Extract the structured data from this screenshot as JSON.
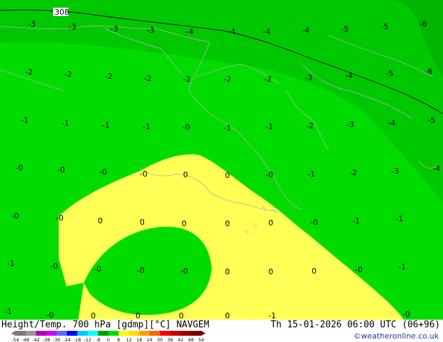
{
  "map": {
    "contour_label": "308",
    "zones": {
      "dark_green": "#00b400",
      "mid_green": "#00c800",
      "bright_green": "#00dc00",
      "yellow": "#ffff55",
      "coast": "#b0b0b0",
      "contour": "#000000"
    },
    "isolines": [
      {
        "t": "-3"
      },
      {
        "t": "-3"
      },
      {
        "t": "-3"
      },
      {
        "t": "-3"
      },
      {
        "t": "-4"
      },
      {
        "t": "-4"
      },
      {
        "t": "-4"
      },
      {
        "t": "-4"
      },
      {
        "t": "-5"
      },
      {
        "t": "-5"
      },
      {
        "t": "-6"
      },
      {
        "t": "-2"
      },
      {
        "t": "-2"
      },
      {
        "t": "-2"
      },
      {
        "t": "-2"
      },
      {
        "t": "-2"
      },
      {
        "t": "-2"
      },
      {
        "t": "-2"
      },
      {
        "t": "-3"
      },
      {
        "t": "-4"
      },
      {
        "t": "-5"
      },
      {
        "t": "-6"
      },
      {
        "t": "-1"
      },
      {
        "t": "-1"
      },
      {
        "t": "-1"
      },
      {
        "t": "-1"
      },
      {
        "t": "-0"
      },
      {
        "t": "-1"
      },
      {
        "t": "-1"
      },
      {
        "t": "-2"
      },
      {
        "t": "-3"
      },
      {
        "t": "-4"
      },
      {
        "t": "-5"
      },
      {
        "t": "-0"
      },
      {
        "t": "-0"
      },
      {
        "t": "-0"
      },
      {
        "t": "-0"
      },
      {
        "t": "0"
      },
      {
        "t": "0"
      },
      {
        "t": "-0"
      },
      {
        "t": "-1"
      },
      {
        "t": "-2"
      },
      {
        "t": "-3"
      },
      {
        "t": "-4"
      },
      {
        "t": "-0"
      },
      {
        "t": "-0"
      },
      {
        "t": "0"
      },
      {
        "t": "0"
      },
      {
        "t": "0"
      },
      {
        "t": "0"
      },
      {
        "t": "0"
      },
      {
        "t": "-0"
      },
      {
        "t": "-1"
      },
      {
        "t": "-1"
      },
      {
        "t": "-1"
      },
      {
        "t": "-0"
      },
      {
        "t": "-0"
      },
      {
        "t": "-0"
      },
      {
        "t": "-0"
      },
      {
        "t": "0"
      },
      {
        "t": "0"
      },
      {
        "t": "0"
      },
      {
        "t": "-0"
      },
      {
        "t": "-1"
      },
      {
        "t": "-1"
      },
      {
        "t": "-0"
      },
      {
        "t": "0"
      },
      {
        "t": "0"
      },
      {
        "t": "0"
      },
      {
        "t": "0"
      },
      {
        "t": "-1"
      },
      {
        "t": "-0"
      }
    ]
  },
  "footer": {
    "title": "Height/Temp. 700 hPa [gdmp][°C] NAVGEM",
    "datetime": "Th 15-01-2026 06:00 UTC (06+96)",
    "credit": "©weatheronline.co.uk",
    "colorbar": {
      "ticks": [
        "-54",
        "-48",
        "-42",
        "-38",
        "-30",
        "-24",
        "-18",
        "-12",
        "-8",
        "0",
        "8",
        "12",
        "18",
        "24",
        "30",
        "36",
        "42",
        "48",
        "54"
      ],
      "colors": [
        "#7a7a7a",
        "#9a9a9a",
        "#b400b4",
        "#d200ff",
        "#6464ff",
        "#0000ff",
        "#00c8ff",
        "#00ffff",
        "#00a000",
        "#00dc00",
        "#ffff00",
        "#ffdc00",
        "#ffa000",
        "#ff6400",
        "#ff0000",
        "#c80000",
        "#a00000",
        "#7a0000"
      ]
    }
  }
}
